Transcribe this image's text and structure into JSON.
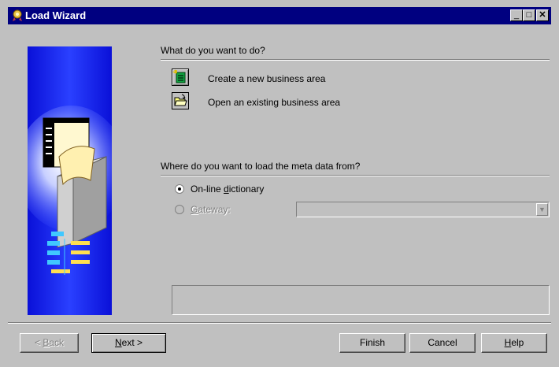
{
  "window": {
    "title": "Load Wizard",
    "controls": {
      "minimize": "_",
      "maximize": "□",
      "close": "✕"
    }
  },
  "illustration": {
    "icon": "wizard-illustration"
  },
  "question1": {
    "label": "What do you want to do?",
    "options": [
      {
        "label": "Create a new business area",
        "icon": "new-business-area-icon",
        "selected": true
      },
      {
        "label": "Open an existing business area",
        "icon": "open-folder-icon",
        "selected": false
      }
    ]
  },
  "question2": {
    "label": "Where do you want to load the meta data from?",
    "online": {
      "pre": "On-line ",
      "accel": "d",
      "post": "ictionary",
      "checked": true
    },
    "gateway": {
      "pre": "",
      "accel": "G",
      "post": "ateway:",
      "checked": false,
      "disabled": true,
      "value": ""
    }
  },
  "message": "",
  "buttons": {
    "back": {
      "pre": "< ",
      "accel": "B",
      "post": "ack",
      "disabled": true
    },
    "next": {
      "pre": "",
      "accel": "N",
      "post": "ext >"
    },
    "finish": {
      "label": "Finish"
    },
    "cancel": {
      "label": "Cancel"
    },
    "help": {
      "pre": "",
      "accel": "H",
      "post": "elp"
    }
  },
  "colors": {
    "titlebar": "#000080",
    "panel_blue": "#1a2ee8",
    "face": "#c0c0c0"
  }
}
